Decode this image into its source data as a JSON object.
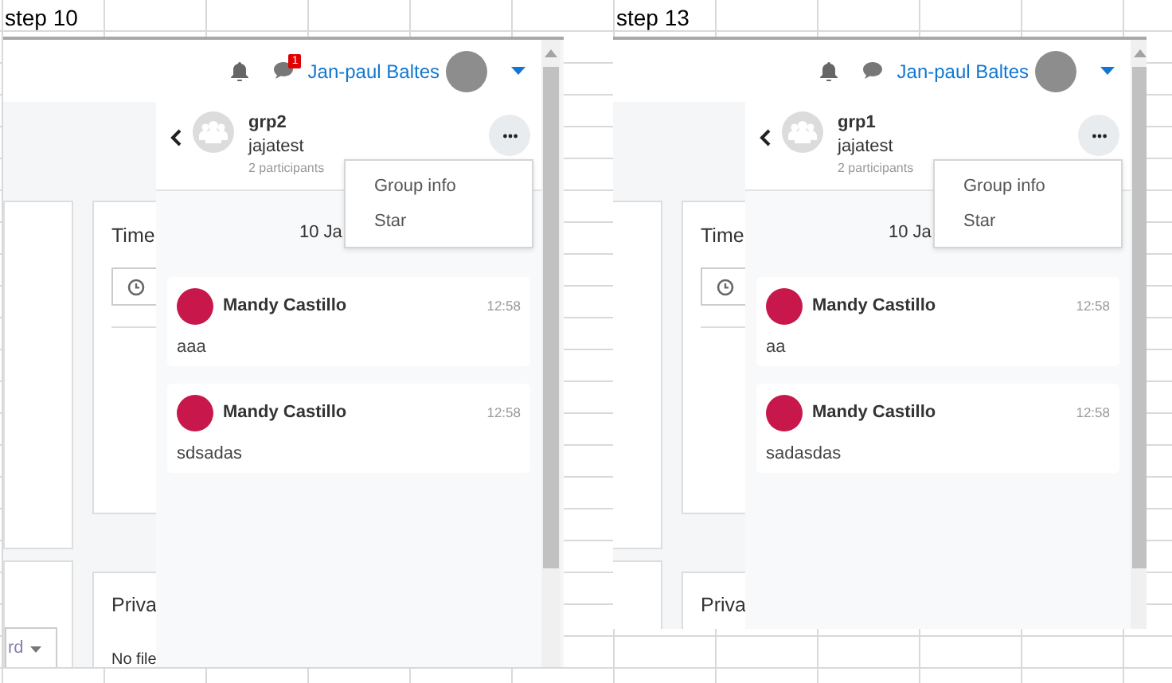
{
  "sheet": {
    "cells": [
      {
        "text": "step 10"
      },
      {
        "text": "step 13"
      }
    ]
  },
  "screenshots": [
    {
      "header": {
        "notification_count": "1",
        "user_name": "Jan-paul Baltes"
      },
      "page": {
        "card_title": "Time",
        "second_card_title": "Priva",
        "empty_text": "No file",
        "select_text": "rd"
      },
      "chat": {
        "group_name": "grp2",
        "subtitle": "jajatest",
        "participants": "2 participants",
        "date": "10 Ja",
        "menu": [
          "Group info",
          "Star"
        ],
        "messages": [
          {
            "sender": "Mandy Castillo",
            "time": "12:58",
            "text": "aaa"
          },
          {
            "sender": "Mandy Castillo",
            "time": "12:58",
            "text": "sdsadas"
          }
        ]
      }
    },
    {
      "header": {
        "user_name": "Jan-paul Baltes"
      },
      "page": {
        "card_title": "Time",
        "second_card_title": "Priva"
      },
      "chat": {
        "group_name": "grp1",
        "subtitle": "jajatest",
        "participants": "2 participants",
        "date": "10 Ja",
        "menu": [
          "Group info",
          "Star"
        ],
        "messages": [
          {
            "sender": "Mandy Castillo",
            "time": "12:58",
            "text": "aa"
          },
          {
            "sender": "Mandy Castillo",
            "time": "12:58",
            "text": "sadasdas"
          }
        ]
      }
    }
  ]
}
